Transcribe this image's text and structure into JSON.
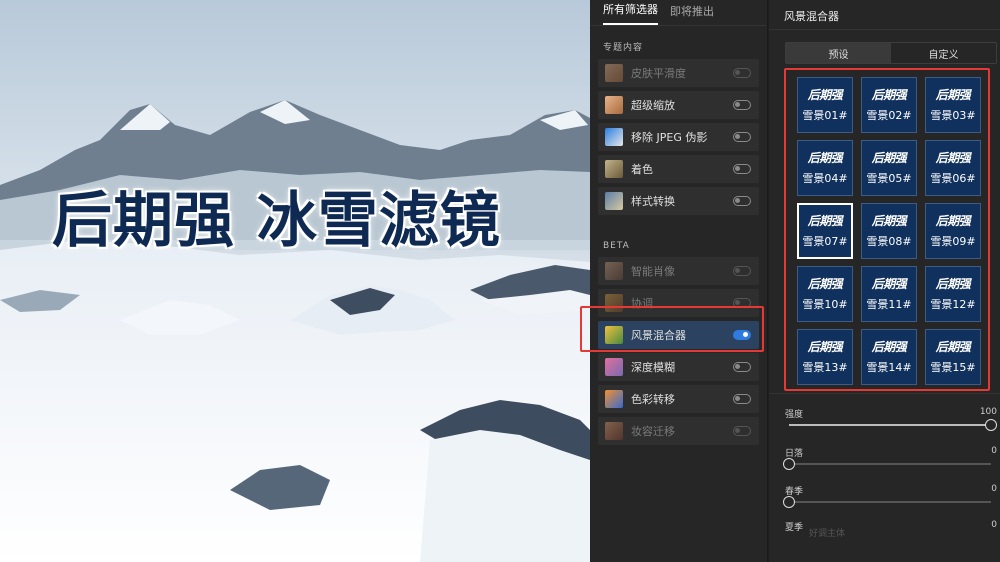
{
  "photo": {
    "headline": "后期强 冰雪滤镜"
  },
  "filters_panel": {
    "tabs": [
      {
        "label": "所有筛选器",
        "active": true
      },
      {
        "label": "即将推出",
        "active": false
      }
    ],
    "sections": [
      {
        "title": "专题内容",
        "items": [
          {
            "label": "皮肤平滑度",
            "icon": "face-icon",
            "enabled": false,
            "dim": true
          },
          {
            "label": "超级缩放",
            "icon": "face-icon",
            "enabled": false,
            "dim": false
          },
          {
            "label": "移除 JPEG 伪影",
            "icon": "jpeg-icon",
            "enabled": false,
            "dim": false
          },
          {
            "label": "着色",
            "icon": "colorize-icon",
            "enabled": false,
            "dim": false
          },
          {
            "label": "样式转换",
            "icon": "style-icon",
            "enabled": false,
            "dim": false
          }
        ]
      },
      {
        "title": "BETA",
        "items": [
          {
            "label": "智能肖像",
            "icon": "portrait-icon",
            "enabled": false,
            "dim": true
          },
          {
            "label": "协调",
            "icon": "harmonize-icon",
            "enabled": false,
            "dim": true
          },
          {
            "label": "风景混合器",
            "icon": "landscape-icon",
            "enabled": true,
            "dim": false
          },
          {
            "label": "深度模糊",
            "icon": "depth-blur-icon",
            "enabled": false,
            "dim": false
          },
          {
            "label": "色彩转移",
            "icon": "color-transfer-icon",
            "enabled": false,
            "dim": false
          },
          {
            "label": "妆容迁移",
            "icon": "makeup-icon",
            "enabled": false,
            "dim": true
          }
        ]
      }
    ]
  },
  "mixer": {
    "title": "风景混合器",
    "segments": [
      {
        "label": "预设",
        "active": true
      },
      {
        "label": "自定义",
        "active": false
      }
    ],
    "presets": [
      {
        "brand": "后期强",
        "name": "雪景01#"
      },
      {
        "brand": "后期强",
        "name": "雪景02#"
      },
      {
        "brand": "后期强",
        "name": "雪景03#"
      },
      {
        "brand": "后期强",
        "name": "雪景04#"
      },
      {
        "brand": "后期强",
        "name": "雪景05#"
      },
      {
        "brand": "后期强",
        "name": "雪景06#"
      },
      {
        "brand": "后期强",
        "name": "雪景07#"
      },
      {
        "brand": "后期强",
        "name": "雪景08#"
      },
      {
        "brand": "后期强",
        "name": "雪景09#"
      },
      {
        "brand": "后期强",
        "name": "雪景10#"
      },
      {
        "brand": "后期强",
        "name": "雪景11#"
      },
      {
        "brand": "后期强",
        "name": "雪景12#"
      },
      {
        "brand": "后期强",
        "name": "雪景13#"
      },
      {
        "brand": "后期强",
        "name": "雪景14#"
      },
      {
        "brand": "后期强",
        "name": "雪景15#"
      }
    ],
    "selected_preset": 6,
    "sliders": [
      {
        "label": "强度",
        "value": "100",
        "fraction": 1.0
      },
      {
        "label": "日落",
        "value": "0",
        "fraction": 0.0
      },
      {
        "label": "春季",
        "value": "0",
        "fraction": 0.0
      },
      {
        "label": "夏季",
        "value": "0",
        "fraction": 0.0
      }
    ],
    "ghost_text": "好调主体"
  },
  "colors": {
    "accent": "#2f7ce0",
    "highlight": "#e53935",
    "preset_bg": "#10305e",
    "headline": "#0f2a52"
  }
}
